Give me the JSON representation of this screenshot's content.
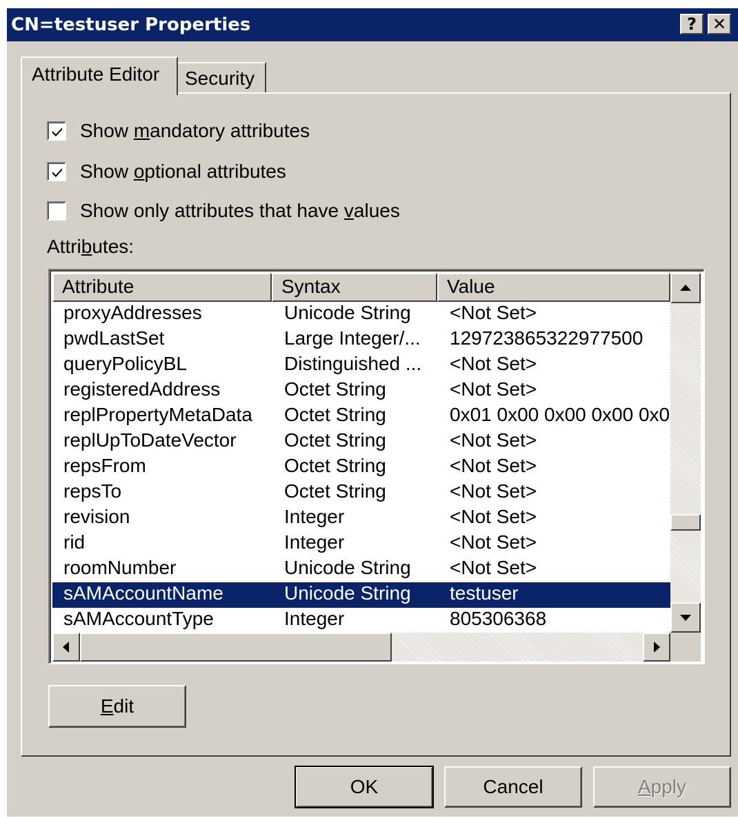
{
  "window": {
    "title": "CN=testuser Properties",
    "help_label": "?",
    "close_label": "✕"
  },
  "tabs": [
    {
      "label": "Attribute Editor",
      "active": true
    },
    {
      "label": "Security",
      "active": false
    }
  ],
  "checkboxes": [
    {
      "pre": "Show ",
      "key": "m",
      "post": "andatory attributes",
      "checked": true
    },
    {
      "pre": "Show ",
      "key": "o",
      "post": "ptional attributes",
      "checked": true
    },
    {
      "pre": "Show only attributes that have ",
      "key": "v",
      "post": "alues",
      "checked": false
    }
  ],
  "attributes_label": {
    "pre": "Attri",
    "key": "b",
    "post": "utes:"
  },
  "table": {
    "columns": [
      "Attribute",
      "Syntax",
      "Value"
    ],
    "rows": [
      {
        "attribute": "proxyAddresses",
        "syntax": "Unicode String",
        "value": "<Not Set>"
      },
      {
        "attribute": "pwdLastSet",
        "syntax": "Large Integer/...",
        "value": "129723865322977500"
      },
      {
        "attribute": "queryPolicyBL",
        "syntax": "Distinguished ...",
        "value": "<Not Set>"
      },
      {
        "attribute": "registeredAddress",
        "syntax": "Octet String",
        "value": "<Not Set>"
      },
      {
        "attribute": "replPropertyMetaData",
        "syntax": "Octet String",
        "value": "0x01 0x00 0x00 0x00 0x0"
      },
      {
        "attribute": "replUpToDateVector",
        "syntax": "Octet String",
        "value": "<Not Set>"
      },
      {
        "attribute": "repsFrom",
        "syntax": "Octet String",
        "value": "<Not Set>"
      },
      {
        "attribute": "repsTo",
        "syntax": "Octet String",
        "value": "<Not Set>"
      },
      {
        "attribute": "revision",
        "syntax": "Integer",
        "value": "<Not Set>"
      },
      {
        "attribute": "rid",
        "syntax": "Integer",
        "value": "<Not Set>"
      },
      {
        "attribute": "roomNumber",
        "syntax": "Unicode String",
        "value": "<Not Set>"
      },
      {
        "attribute": "sAMAccountName",
        "syntax": "Unicode String",
        "value": "testuser",
        "selected": true
      },
      {
        "attribute": "sAMAccountType",
        "syntax": "Integer",
        "value": "805306368"
      }
    ]
  },
  "edit_button": {
    "key": "E",
    "post": "dit"
  },
  "footer": {
    "ok_label": "OK",
    "cancel_label": "Cancel",
    "apply_key": "A",
    "apply_post": "pply"
  },
  "colors": {
    "titlebar": "#0a246a",
    "face": "#d4d0c8",
    "selection": "#0a246a"
  },
  "icons": [
    "help-icon",
    "close-icon",
    "checkmark-icon",
    "scroll-up-icon",
    "scroll-down-icon",
    "scroll-left-icon",
    "scroll-right-icon"
  ]
}
